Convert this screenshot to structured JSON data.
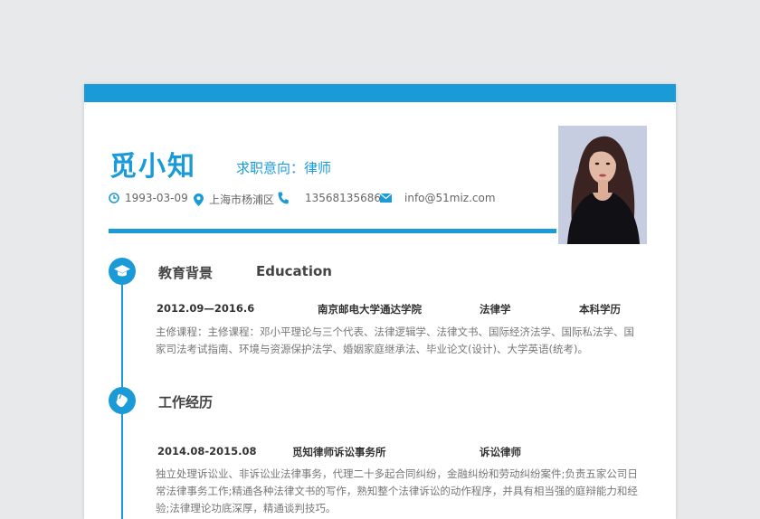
{
  "resume": {
    "name": "觅小知",
    "job_intent": "求职意向：律师",
    "birth": "1993-03-09",
    "location": "上海市杨浦区",
    "phone": "13568135686",
    "email": "info@51miz.com"
  },
  "education": {
    "title_cn": "教育背景",
    "title_en": "Education",
    "period": "2012.09—2016.6",
    "school": "南京邮电大学通达学院",
    "major": "法律学",
    "degree": "本科学历",
    "courses": "主修课程：主修课程：邓小平理论与三个代表、法律逻辑学、法律文书、国际经济法学、国际私法学、国家司法考试指南、环境与资源保护法学、婚姻家庭继承法、毕业论文(设计)、大学英语(统考)。"
  },
  "work": {
    "title_cn": "工作经历",
    "period": "2014.08-2015.08",
    "company": "觅知律师诉讼事务所",
    "position": "诉讼律师",
    "description": "独立处理诉讼业、非诉讼业法律事务，代理二十多起合同纠纷，金融纠纷和劳动纠纷案件;负责五家公司日常法律事务工作;精通各种法律文书的写作，熟知整个法律诉讼的动作程序，并具有相当强的庭辩能力和经验;法律理论功底深厚，精通谈判技巧。"
  },
  "colors": {
    "accent": "#1a9bd7",
    "text": "#333333",
    "muted": "#777777"
  }
}
